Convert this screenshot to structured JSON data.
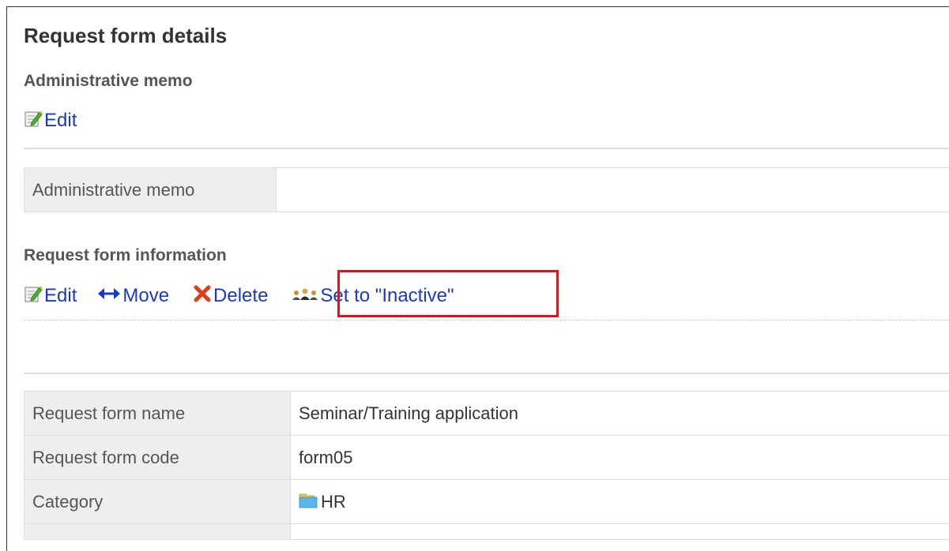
{
  "page": {
    "title": "Request form details"
  },
  "admin_memo_section": {
    "heading": "Administrative memo",
    "edit_label": "Edit",
    "table": {
      "label": "Administrative memo",
      "value": ""
    }
  },
  "request_form_section": {
    "heading": "Request form information",
    "actions": {
      "edit_label": "Edit",
      "move_label": "Move",
      "delete_label": "Delete",
      "inactive_label": "Set to \"Inactive\""
    },
    "rows": [
      {
        "label": "Request form name",
        "value": "Seminar/Training application"
      },
      {
        "label": "Request form code",
        "value": "form05"
      },
      {
        "label": "Category",
        "value": "HR"
      }
    ]
  },
  "icons": {
    "edit": "edit-pencil-icon",
    "move": "move-arrows-icon",
    "delete": "delete-x-icon",
    "inactive": "inactive-users-icon",
    "category": "folder-icon"
  },
  "colors": {
    "link": "#1a39c8",
    "highlight": "#e0141b",
    "delete_icon": "#e03c1e",
    "label_bg": "#eeeeee"
  }
}
